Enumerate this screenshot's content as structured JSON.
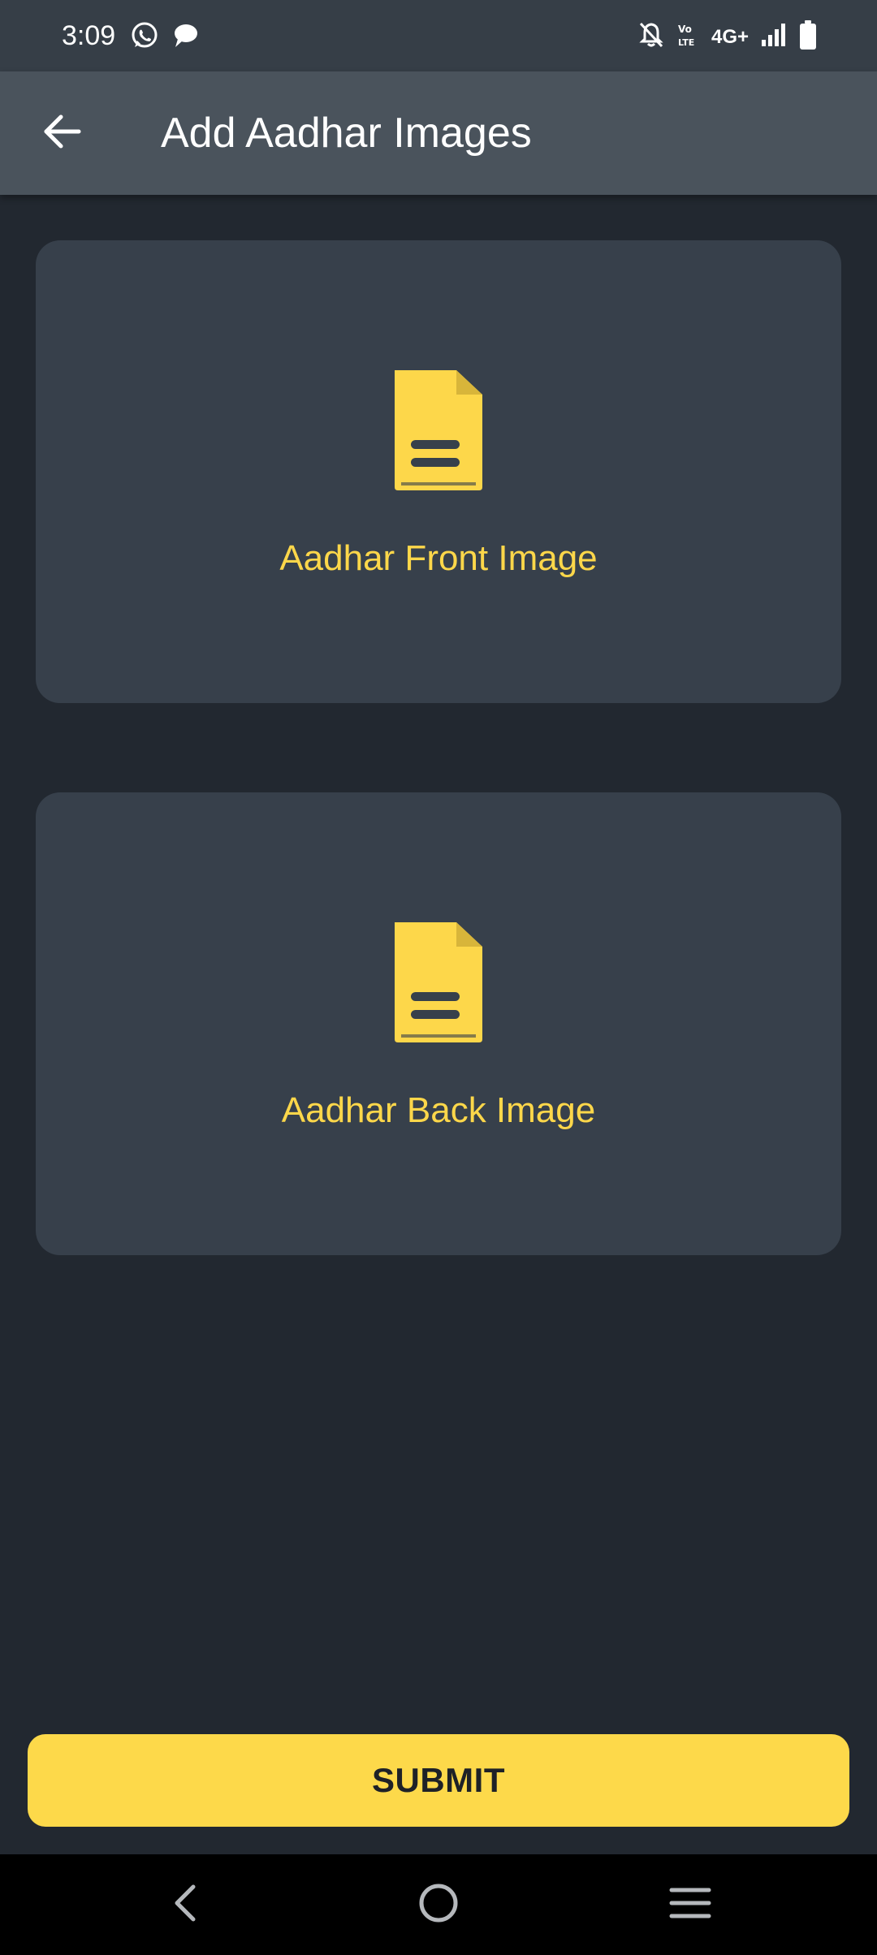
{
  "status_bar": {
    "time": "3:09",
    "network_label": "4G+",
    "icons": [
      "whatsapp-icon",
      "message-icon",
      "mute-notification-icon",
      "volte-icon",
      "signal-icon",
      "battery-icon"
    ]
  },
  "app_bar": {
    "title": "Add Aadhar Images",
    "back_icon": "arrow-left-icon"
  },
  "cards": [
    {
      "label": "Aadhar Front Image",
      "icon": "document-icon"
    },
    {
      "label": "Aadhar Back Image",
      "icon": "document-icon"
    }
  ],
  "submit_label": "SUBMIT",
  "colors": {
    "accent": "#fdd94a",
    "background": "#222830",
    "card": "#37404b",
    "app_bar": "#4a535c"
  },
  "nav_bar": {
    "icons": [
      "nav-back-icon",
      "nav-home-icon",
      "nav-menu-icon"
    ]
  }
}
